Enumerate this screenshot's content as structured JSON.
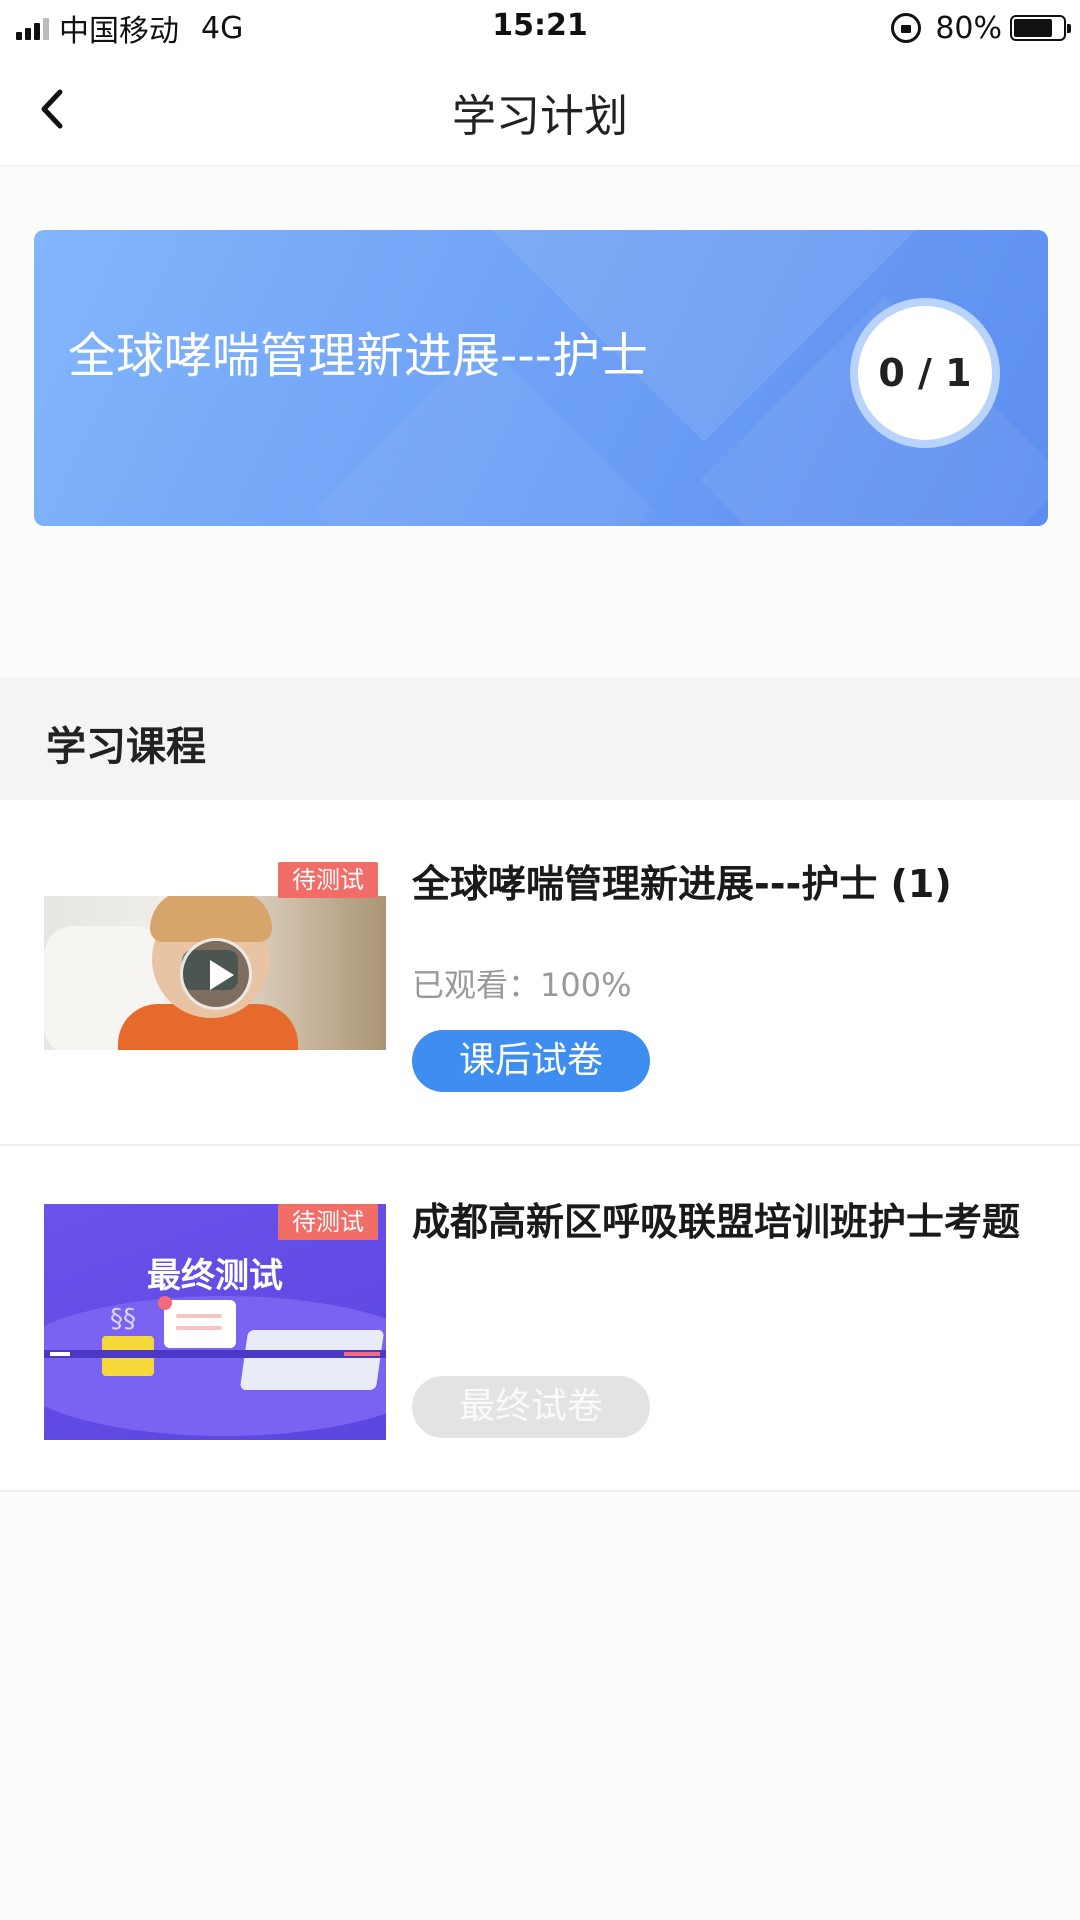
{
  "status_bar": {
    "carrier": "中国移动",
    "network": "4G",
    "time": "15:21",
    "battery_percent": "80%",
    "battery_level": 0.8
  },
  "nav": {
    "back_icon": "chevron-left-icon",
    "title": "学习计划"
  },
  "banner": {
    "title": "全球哮喘管理新进展---护士",
    "progress": "0 / 1",
    "colors": {
      "gradient_start": "#82b6fb",
      "gradient_end": "#5d8ef0"
    }
  },
  "section": {
    "title": "学习课程"
  },
  "courses": [
    {
      "badge": "待测试",
      "thumbnail": "video-thumbnail",
      "play_icon": "play-icon",
      "title": "全球哮喘管理新进展---护士 (1)",
      "watched": "已观看：100%",
      "button": "课后试卷",
      "button_state": "active"
    },
    {
      "badge": "待测试",
      "thumbnail": "final-test-thumbnail",
      "thumbnail_text": "最终测试",
      "title": "成都高新区呼吸联盟培训班护士考题",
      "button": "最终试卷",
      "button_state": "disabled"
    }
  ],
  "colors": {
    "primary": "#3d8ef0",
    "badge": "#f06d68",
    "disabled": "#e3e3e3"
  }
}
